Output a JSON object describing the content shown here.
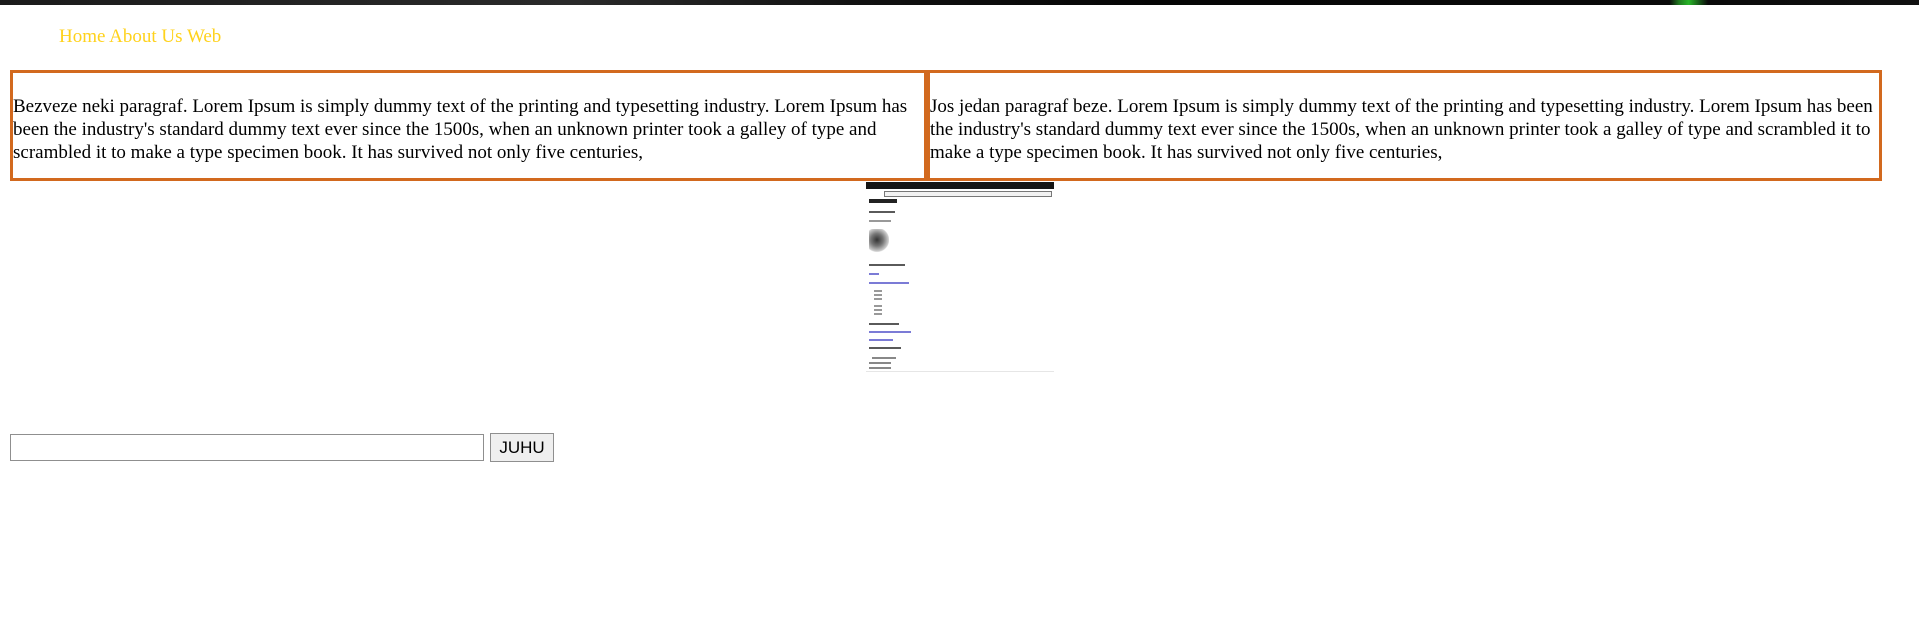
{
  "nav": {
    "home": "Home",
    "about": "About Us",
    "web": "Web"
  },
  "paragraphs": {
    "left": "Bezveze neki paragraf. Lorem Ipsum is simply dummy text of the printing and typesetting industry. Lorem Ipsum has been the industry's standard dummy text ever since the 1500s, when an unknown printer took a galley of type and scrambled it to make a type specimen book. It has survived not only five centuries,",
    "right": "Jos jedan paragraf beze. Lorem Ipsum is simply dummy text of the printing and typesetting industry. Lorem Ipsum has been the industry's standard dummy text ever since the 1500s, when an unknown printer took a galley of type and scrambled it to make a type specimen book. It has survived not only five centuries,"
  },
  "search": {
    "value": "",
    "button_label": "JUHU"
  },
  "colors": {
    "nav_link": "#ffd21c",
    "box_border": "#d2691e"
  }
}
